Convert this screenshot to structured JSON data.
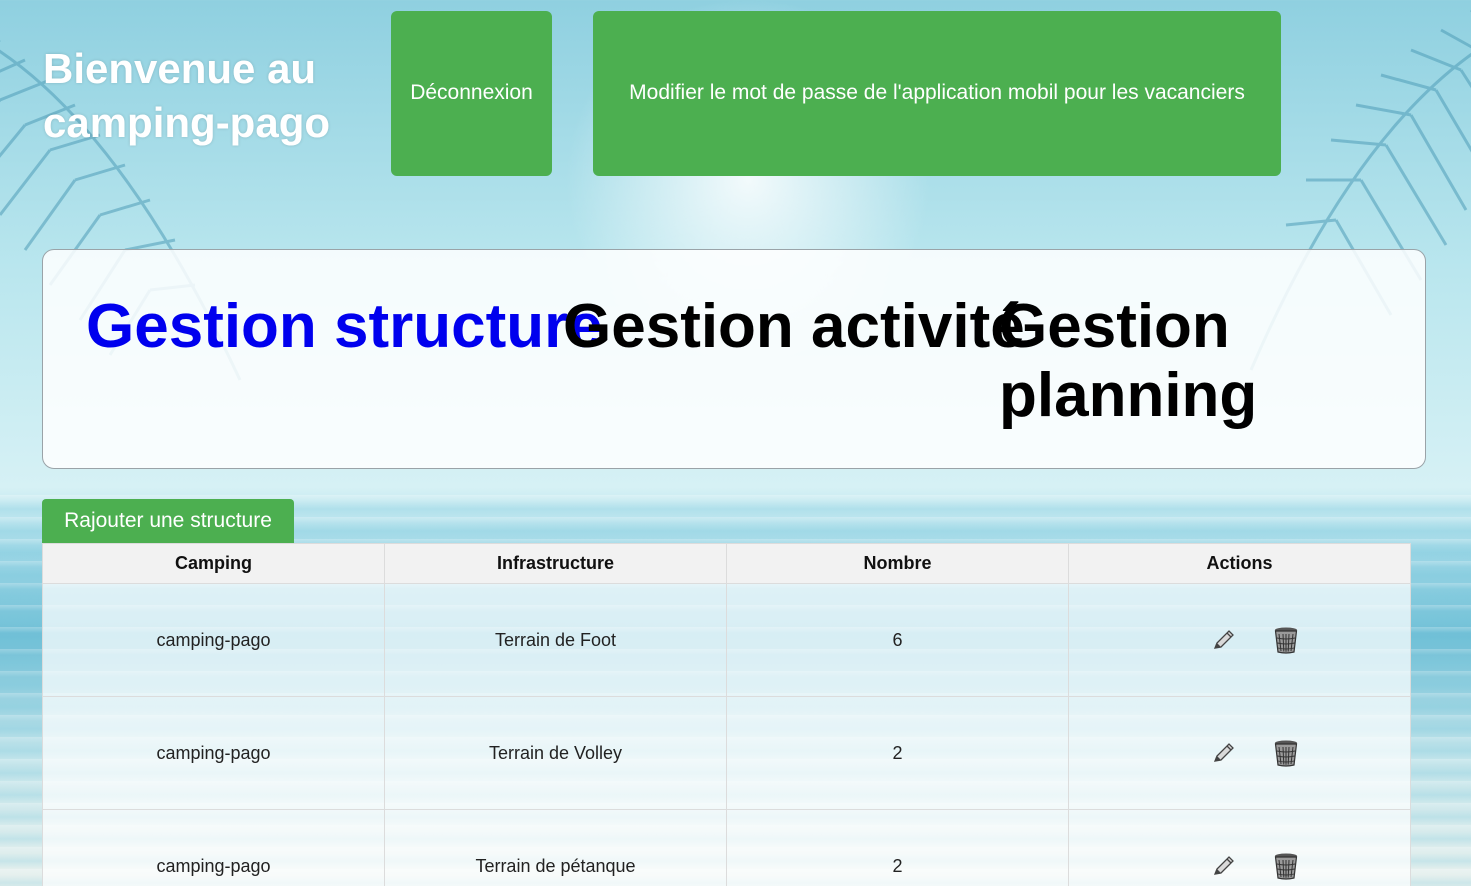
{
  "header": {
    "title": "Bienvenue au camping-pago",
    "logout_label": "Déconnexion",
    "change_password_label": "Modifier le mot de passe de l'application mobil pour les vacanciers"
  },
  "nav": {
    "items": [
      {
        "label": "Gestion structure",
        "active": true
      },
      {
        "label": "Gestion activité",
        "active": false
      },
      {
        "label": "Gestion planning",
        "active": false
      }
    ]
  },
  "toolbar": {
    "add_label": "Rajouter une structure"
  },
  "table": {
    "columns": [
      "Camping",
      "Infrastructure",
      "Nombre",
      "Actions"
    ],
    "rows": [
      {
        "camping": "camping-pago",
        "infrastructure": "Terrain de Foot",
        "nombre": "6"
      },
      {
        "camping": "camping-pago",
        "infrastructure": "Terrain de Volley",
        "nombre": "2"
      },
      {
        "camping": "camping-pago",
        "infrastructure": "Terrain de pétanque",
        "nombre": "2"
      }
    ],
    "row_actions": [
      {
        "icon": "pencil-icon"
      },
      {
        "icon": "trash-icon"
      }
    ]
  },
  "colors": {
    "button_green": "#4caf50",
    "active_link": "#0000ee"
  }
}
